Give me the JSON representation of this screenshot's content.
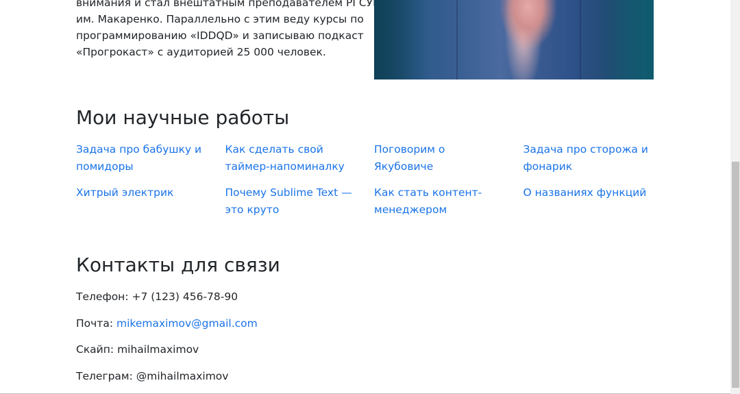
{
  "intro": {
    "lines": [
      "внимания и стал внештатным преподавателем РГСУМ",
      "им. Макаренко. Параллельно с этим веду курсы по",
      "программированию «IDDQD» и записываю подкаст",
      "«Прогрокаст» с аудиторией 25 000 человек."
    ]
  },
  "works": {
    "title": "Мои научные работы",
    "columns": [
      [
        "Задача про бабушку и помидоры",
        "Хитрый электрик"
      ],
      [
        "Как сделать свой таймер-напоминалку",
        "Почему Sublime Text — это круто"
      ],
      [
        "Поговорим о Якубовиче",
        "Как стать контент-менеджером"
      ],
      [
        "Задача про сторожа и фонарик",
        "О названиях функций"
      ]
    ]
  },
  "contacts": {
    "title": "Контакты для связи",
    "phone_label": "Телефон:",
    "phone_value": "+7 (123) 456-78-90",
    "email_label": "Почта:",
    "email_value": "mikemaximov@gmail.com",
    "skype_label": "Скайп:",
    "skype_value": "mihailmaximov",
    "telegram_label": "Телеграм:",
    "telegram_value": "@mihailmaximov"
  },
  "colors": {
    "link": "#1a73e8",
    "text": "#212529",
    "background": "#ffffff"
  }
}
